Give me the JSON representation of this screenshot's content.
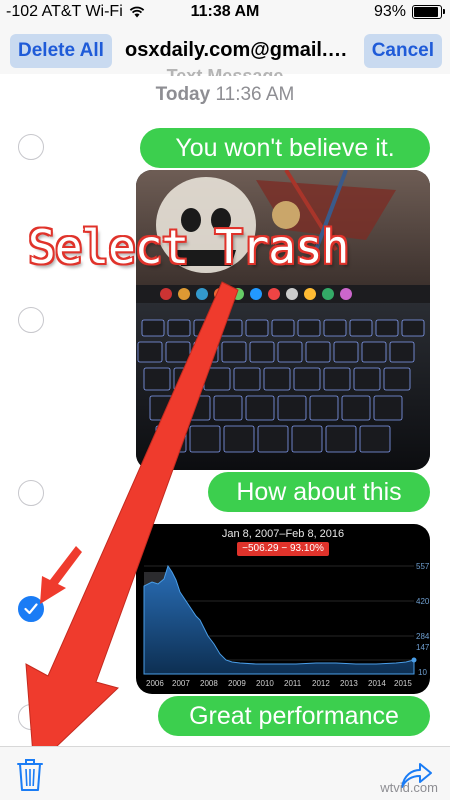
{
  "status_bar": {
    "carrier": "-102 AT&T Wi-Fi",
    "time": "11:38 AM",
    "battery_percent": "93%",
    "battery_level": 0.93
  },
  "nav": {
    "left_button": "Delete All",
    "title": "osxdaily.com@gmail.com",
    "right_button": "Cancel"
  },
  "conversation": {
    "cut_header": "Text Message",
    "timestamp_day": "Today",
    "timestamp_time": "11:36 AM",
    "messages": [
      {
        "type": "text",
        "text": "You won't believe it.",
        "selected": false
      },
      {
        "type": "image",
        "description": "photo",
        "selected": false
      },
      {
        "type": "text",
        "text": "How about this",
        "selected": false
      },
      {
        "type": "image",
        "description": "chart",
        "selected": true
      },
      {
        "type": "text",
        "text": "Great performance",
        "selected": false
      }
    ]
  },
  "embedded_chart": {
    "date_range": "Jan 8, 2007–Feb 8, 2016",
    "change": "−506.29 − 93.10%",
    "y_ticks": [
      "557",
      "420",
      "284",
      "147",
      "10"
    ],
    "x_ticks": [
      "2006",
      "2007",
      "2008",
      "2009",
      "2010",
      "2011",
      "2012",
      "2013",
      "2014",
      "2015"
    ]
  },
  "annotation": {
    "text": "Select Trash",
    "color": "#e0332b"
  },
  "toolbar": {
    "trash_icon": "trash-icon",
    "share_icon": "share-icon"
  },
  "watermark": "wtvid.com",
  "colors": {
    "bubble": "#3ccf4e",
    "accent": "#1a7cf5",
    "nav_button_text": "#1f5bd8"
  }
}
